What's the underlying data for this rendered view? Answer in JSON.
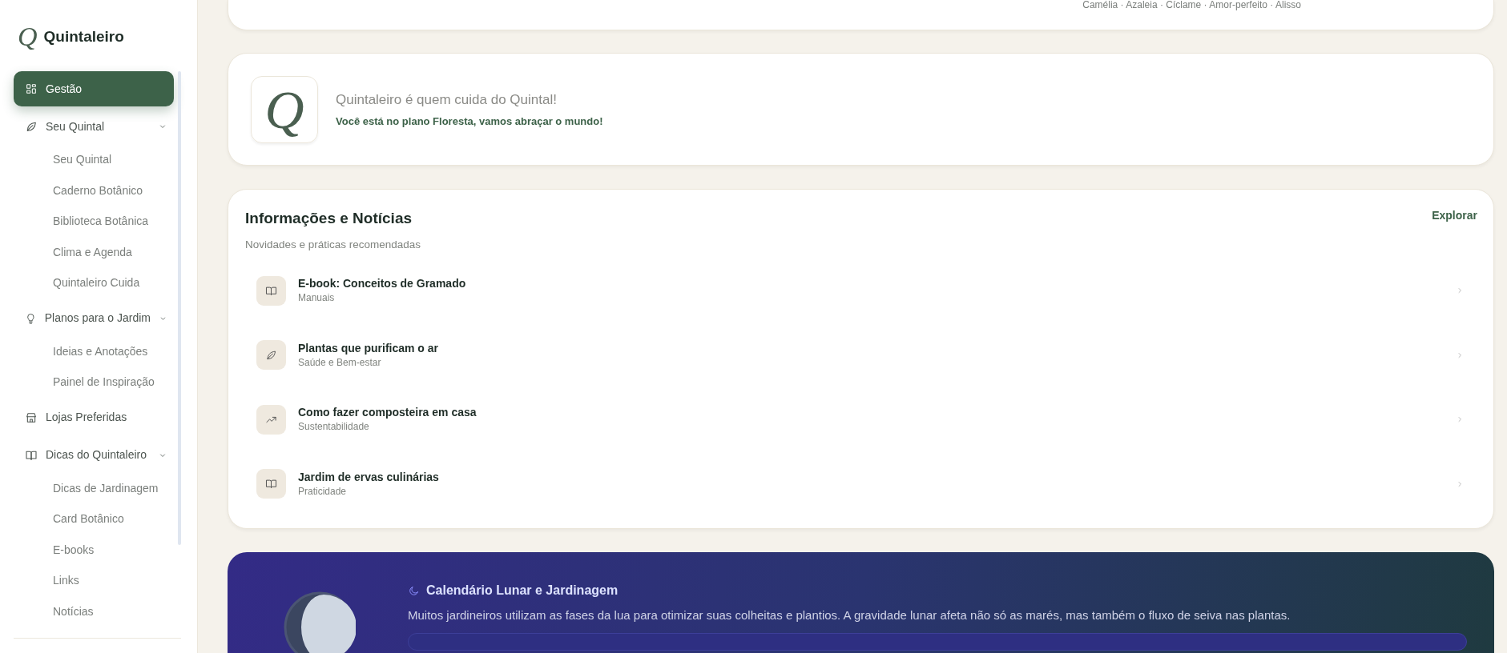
{
  "sidebar": {
    "logo_mark": "Q",
    "brand": "Quintaleiro",
    "items": [
      {
        "label": "Gestão",
        "selected": true
      },
      {
        "label": "Seu Quintal",
        "selected": false,
        "expanded": true,
        "children": [
          {
            "label": "Seu Quintal",
            "selected": false
          },
          {
            "label": "Caderno Botânico",
            "selected": false
          },
          {
            "label": "Biblioteca Botânica",
            "selected": false
          },
          {
            "label": "Clima e Agenda",
            "selected": false
          },
          {
            "label": "Quintaleiro Cuida",
            "selected": false
          }
        ]
      },
      {
        "label": "Planos para o Jardim",
        "selected": false,
        "expanded": true,
        "children": [
          {
            "label": "Ideias e Anotações",
            "selected": false
          },
          {
            "label": "Painel de Inspiração",
            "selected": false
          }
        ]
      },
      {
        "label": "Lojas Preferidas",
        "selected": false
      },
      {
        "label": "Dicas do Quintaleiro",
        "selected": false,
        "expanded": true,
        "children": [
          {
            "label": "Dicas de Jardinagem",
            "selected": false
          },
          {
            "label": "Card Botânico",
            "selected": false
          },
          {
            "label": "E-books",
            "selected": false
          },
          {
            "label": "Links",
            "selected": false
          },
          {
            "label": "Notícias",
            "selected": false
          }
        ]
      }
    ]
  },
  "top_card": {
    "flowers": "Camélia · Azaleia · Cíclame · Amor-perfeito · Alisso"
  },
  "welcome_card": {
    "logo_mark": "Q",
    "title": "Quintaleiro é quem cuida do Quintal!",
    "plan_message": "Você está no plano Floresta, vamos abraçar o mundo!"
  },
  "news": {
    "title": "Informações e Notícias",
    "subtitle": "Novidades e práticas recomendadas",
    "explore": "Explorar",
    "items": [
      {
        "title": "E-book: Conceitos de Gramado",
        "category": "Manuais"
      },
      {
        "title": "Plantas que purificam o ar",
        "category": "Saúde e Bem-estar"
      },
      {
        "title": "Como fazer composteira em casa",
        "category": "Sustentabilidade"
      },
      {
        "title": "Jardim de ervas culinárias",
        "category": "Praticidade"
      }
    ]
  },
  "lunar": {
    "title": "Calendário Lunar e Jardinagem",
    "text": "Muitos jardineiros utilizam as fases da lua para otimizar suas colheitas e plantios. A gravidade lunar afeta não só as marés, mas também o fluxo de seiva nas plantas."
  }
}
